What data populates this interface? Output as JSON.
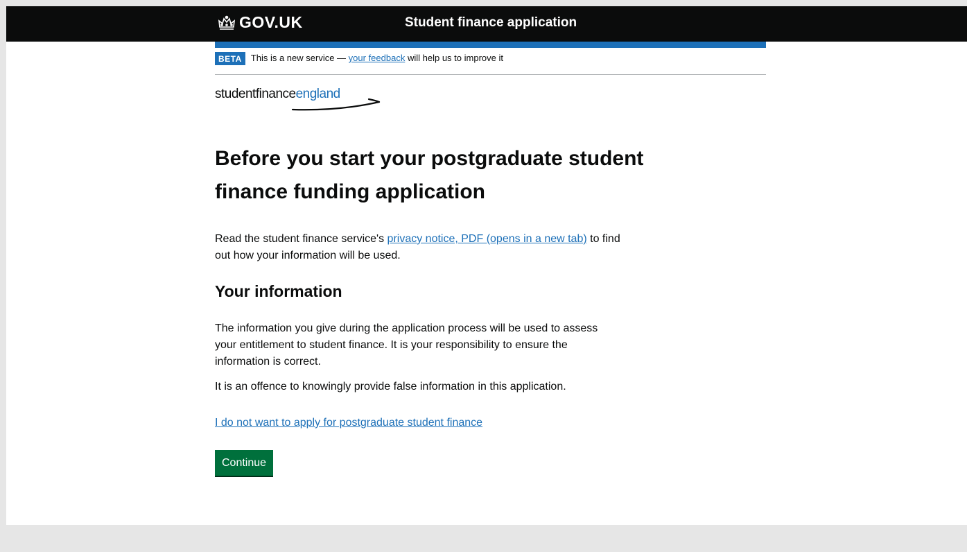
{
  "header": {
    "logo_text": "GOV.UK",
    "service_name": "Student finance application"
  },
  "phase_banner": {
    "tag": "BETA",
    "text_before": "This is a new service —",
    "link_text": "your feedback",
    "text_after": "will help us to improve it"
  },
  "brand": {
    "student_finance": "studentfinance",
    "england": "england"
  },
  "main": {
    "heading": "Before you start your postgraduate student finance funding application",
    "privacy_before": "Read the student finance service's",
    "privacy_link": "privacy notice, PDF (opens in a new tab)",
    "privacy_after": "to find out how your information will be used.",
    "subheading": "Your information",
    "info_paragraph": "The information you give during the application process will be used to assess your entitlement to student finance. It is your responsibility to ensure the information is correct.",
    "offence_paragraph": "It is an offence to knowingly provide false information in this application.",
    "opt_out_link": "I do not want to apply for postgraduate student finance",
    "continue_label": "Continue"
  },
  "colors": {
    "header_bg": "#0b0c0c",
    "link": "#1d70b8",
    "button": "#00703c",
    "footer_bg": "#e6e6e6"
  }
}
